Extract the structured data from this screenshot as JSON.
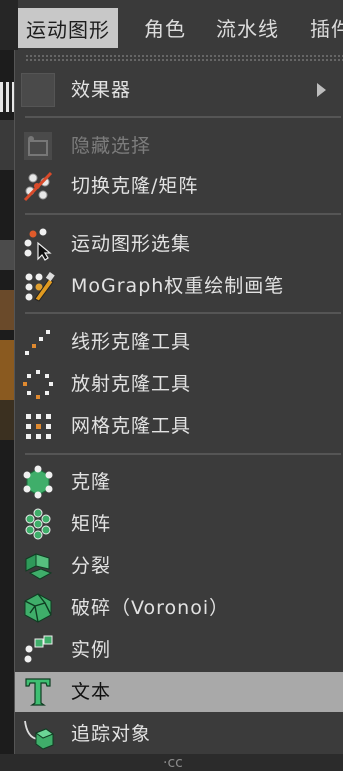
{
  "menubar": {
    "items": [
      {
        "label": "运动图形",
        "active": true
      },
      {
        "label": "角色"
      },
      {
        "label": "流水线"
      },
      {
        "label": "插件"
      }
    ]
  },
  "dropdown": {
    "items": [
      {
        "label": "效果器",
        "icon": "blank-icon",
        "has_submenu": true
      },
      {
        "label": "隐藏选择",
        "icon": "hide-selection-icon",
        "disabled": true
      },
      {
        "label": "切换克隆/矩阵",
        "icon": "toggle-clone-icon"
      },
      {
        "label": "运动图形选集",
        "icon": "mograph-selection-icon"
      },
      {
        "label": "MoGraph权重绘制画笔",
        "icon": "weight-paint-brush-icon"
      },
      {
        "label": "线形克隆工具",
        "icon": "linear-clone-icon"
      },
      {
        "label": "放射克隆工具",
        "icon": "radial-clone-icon"
      },
      {
        "label": "网格克隆工具",
        "icon": "grid-clone-icon"
      },
      {
        "label": "克隆",
        "icon": "cloner-icon"
      },
      {
        "label": "矩阵",
        "icon": "matrix-icon"
      },
      {
        "label": "分裂",
        "icon": "fracture-icon"
      },
      {
        "label": "破碎（Voronoi）",
        "icon": "voronoi-fracture-icon"
      },
      {
        "label": "实例",
        "icon": "instance-icon"
      },
      {
        "label": "文本",
        "icon": "text-icon",
        "highlighted": true
      },
      {
        "label": "追踪对象",
        "icon": "tracer-icon"
      }
    ]
  },
  "watermark": "·cc"
}
